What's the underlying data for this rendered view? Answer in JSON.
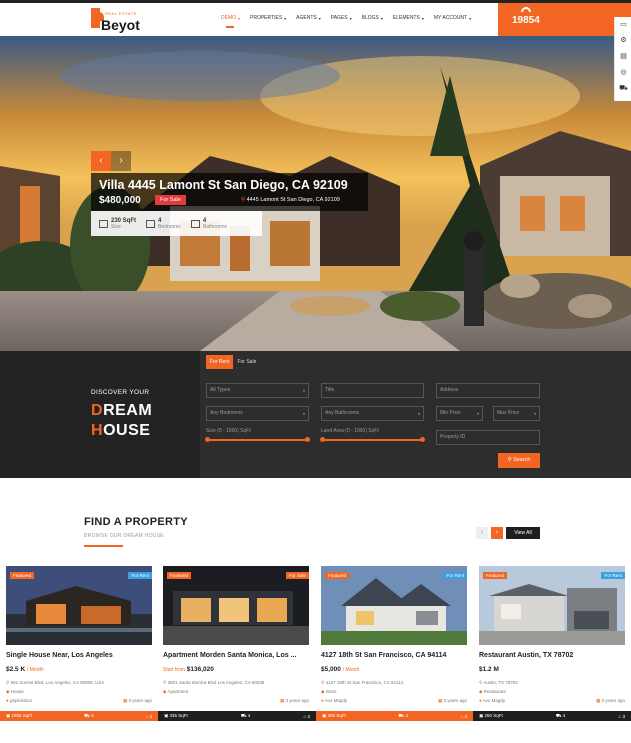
{
  "header": {
    "logo_small": "REAL ESTATE",
    "logo_text": "Beyot",
    "nav": [
      "DEMO",
      "PROPERTIES",
      "AGENTS",
      "PAGES",
      "BLOGS",
      "ELEMENTS",
      "MY ACCOUNT"
    ],
    "phone": "19854"
  },
  "hero": {
    "title": "Villa 4445 Lamont St San Diego, CA 92109",
    "price": "$480,000",
    "status": "For Sale",
    "address": "4445 Lamont St San Diego, CA 92109",
    "size_value": "230 SqFt",
    "size_label": "Size",
    "bed_value": "4",
    "bed_label": "Bedrooms",
    "bath_value": "4",
    "bath_label": "Bathrooms"
  },
  "search": {
    "discover": "DISCOVER YOUR",
    "dream_line1_first": "D",
    "dream_line1_rest": "REAM",
    "dream_line2_first": "H",
    "dream_line2_rest": "OUSE",
    "tab_rent": "For Rent",
    "tab_sale": "For Sale",
    "types": "All Types",
    "title": "Title",
    "address": "Address",
    "bedrooms": "Any Bedrooms",
    "bathrooms": "Any Bathrooms",
    "min_price": "Min Price",
    "max_price": "Max Price",
    "size_range": "Size (0 - 1000) SqFt",
    "land_range": "Land Area (0 - 1000) SqFt",
    "property_id": "Property ID",
    "button": "Search"
  },
  "section": {
    "title": "FIND A PROPERTY",
    "subtitle": "BROWSE OUR DREAM HOUSE",
    "view_all": "View All"
  },
  "cards": [
    {
      "name": "Single House Near, Los Angeles",
      "price": "$2.5 K",
      "unit": "/ Month",
      "start": "",
      "addr": "591 Sunset Blvd, Los Angeles, CA 90008, USA",
      "type": "House",
      "agent": "g5plusskcs",
      "ago": "3 years ago",
      "size": "1856 SqFt",
      "beds": "3",
      "baths": "3",
      "featured": "Featured",
      "status": "For Rent"
    },
    {
      "name": "Apartment Morden Santa Monica, Los ...",
      "price": "$136,020",
      "unit": "",
      "start": "Start from",
      "addr": "3601 Santa Monica Blvd Los Angeles, CA 90038",
      "type": "Apartment",
      "agent": "",
      "ago": "3 years ago",
      "size": "336 SqFt",
      "beds": "4",
      "baths": "3",
      "featured": "Featured",
      "status": "For Sale"
    },
    {
      "name": "4127 18th St San Francisco, CA 94114",
      "price": "$5,000",
      "unit": "/ Month",
      "start": "",
      "addr": "4127 18th St San Francisco, CA 94114",
      "type": "Store",
      "agent": "Avo Magdy",
      "ago": "3 years ago",
      "size": "300 SqFt",
      "beds": "4",
      "baths": "3",
      "featured": "Featured",
      "status": "For Rent"
    },
    {
      "name": "Restaurant Austin, TX 78702",
      "price": "$1.2 M",
      "unit": "",
      "start": "",
      "addr": "Austin, TX 78702",
      "type": "Restaurant",
      "agent": "Avo Magdy",
      "ago": "3 years ago",
      "size": "260 SqFt",
      "beds": "4",
      "baths": "3",
      "featured": "Featured",
      "status": "For Rent"
    }
  ],
  "colors": {
    "accent": "#f26522",
    "dark": "#232323",
    "rent": "#3aa0e0"
  }
}
